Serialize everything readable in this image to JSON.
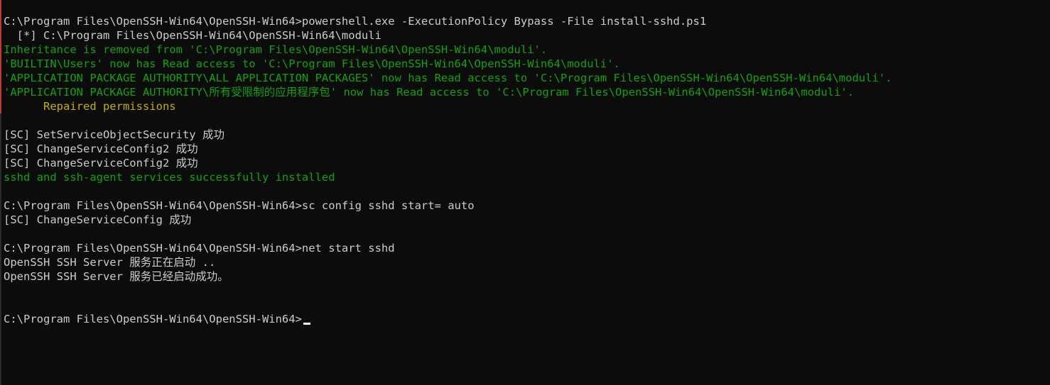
{
  "terminal": {
    "colors": {
      "background": "#0c0c0c",
      "text": "#cccccc",
      "success": "#13a10e",
      "warning": "#c1b000",
      "cursor": "#ffffff"
    },
    "lines": [
      {
        "text": "C:\\Program Files\\OpenSSH-Win64\\OpenSSH-Win64>powershell.exe -ExecutionPolicy Bypass -File install-sshd.ps1",
        "color": "gray"
      },
      {
        "text": "  [*] C:\\Program Files\\OpenSSH-Win64\\OpenSSH-Win64\\moduli",
        "color": "gray"
      },
      {
        "text": "Inheritance is removed from 'C:\\Program Files\\OpenSSH-Win64\\OpenSSH-Win64\\moduli'.",
        "color": "green"
      },
      {
        "text": "'BUILTIN\\Users' now has Read access to 'C:\\Program Files\\OpenSSH-Win64\\OpenSSH-Win64\\moduli'.",
        "color": "green"
      },
      {
        "text": "'APPLICATION PACKAGE AUTHORITY\\ALL APPLICATION PACKAGES' now has Read access to 'C:\\Program Files\\OpenSSH-Win64\\OpenSSH-Win64\\moduli'.",
        "color": "green"
      },
      {
        "text": "'APPLICATION PACKAGE AUTHORITY\\所有受限制的应用程序包' now has Read access to 'C:\\Program Files\\OpenSSH-Win64\\OpenSSH-Win64\\moduli'.",
        "color": "green"
      },
      {
        "text": "      Repaired permissions",
        "color": "yellow"
      },
      {
        "text": "",
        "color": "gray"
      },
      {
        "text": "[SC] SetServiceObjectSecurity 成功",
        "color": "gray"
      },
      {
        "text": "[SC] ChangeServiceConfig2 成功",
        "color": "gray"
      },
      {
        "text": "[SC] ChangeServiceConfig2 成功",
        "color": "gray"
      },
      {
        "text": "sshd and ssh-agent services successfully installed",
        "color": "green"
      },
      {
        "text": "",
        "color": "gray"
      },
      {
        "text": "C:\\Program Files\\OpenSSH-Win64\\OpenSSH-Win64>sc config sshd start= auto",
        "color": "gray"
      },
      {
        "text": "[SC] ChangeServiceConfig 成功",
        "color": "gray"
      },
      {
        "text": "",
        "color": "gray"
      },
      {
        "text": "C:\\Program Files\\OpenSSH-Win64\\OpenSSH-Win64>net start sshd",
        "color": "gray"
      },
      {
        "text": "OpenSSH SSH Server 服务正在启动 ..",
        "color": "gray"
      },
      {
        "text": "OpenSSH SSH Server 服务已经启动成功。",
        "color": "gray"
      },
      {
        "text": "",
        "color": "gray"
      },
      {
        "text": "",
        "color": "gray"
      }
    ],
    "prompt": "C:\\Program Files\\OpenSSH-Win64\\OpenSSH-Win64>"
  }
}
